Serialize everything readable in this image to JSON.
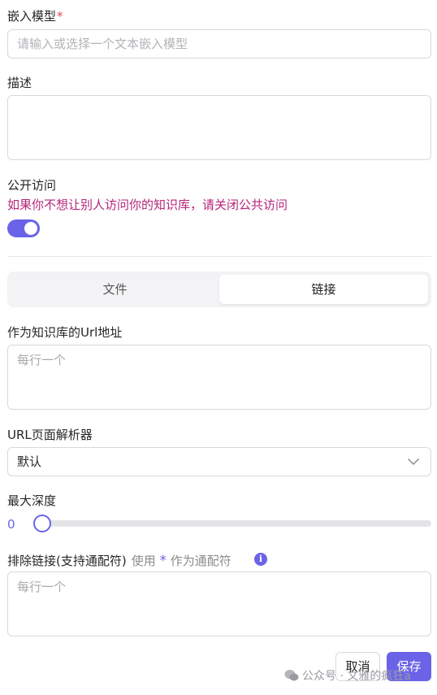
{
  "embed_model": {
    "label": "嵌入模型",
    "required_mark": "*",
    "placeholder": "请输入或选择一个文本嵌入模型"
  },
  "description": {
    "label": "描述",
    "value": ""
  },
  "public_access": {
    "label": "公开访问",
    "warning": "如果你不想让别人访问你的知识库，请关闭公共访问",
    "enabled": true
  },
  "source_tabs": {
    "items": [
      {
        "label": "文件",
        "selected": false
      },
      {
        "label": "链接",
        "selected": true
      }
    ]
  },
  "url_input": {
    "label": "作为知识库的Url地址",
    "placeholder": "每行一个"
  },
  "url_parser": {
    "label": "URL页面解析器",
    "selected": "默认"
  },
  "max_depth": {
    "label": "最大深度",
    "value": "0"
  },
  "exclude_links": {
    "label": "排除链接(支持通配符)",
    "hint_prefix": "使用",
    "hint_star": "*",
    "hint_suffix": "作为通配符",
    "info_glyph": "i",
    "placeholder": "每行一个"
  },
  "footer": {
    "cancel_label": "取消",
    "save_label": "保存"
  },
  "watermark": {
    "text": "公众号 · 文雅的疯狂a"
  },
  "colors": {
    "accent": "#6a63e8",
    "warning": "#b5267a",
    "required": "#e5484d"
  }
}
